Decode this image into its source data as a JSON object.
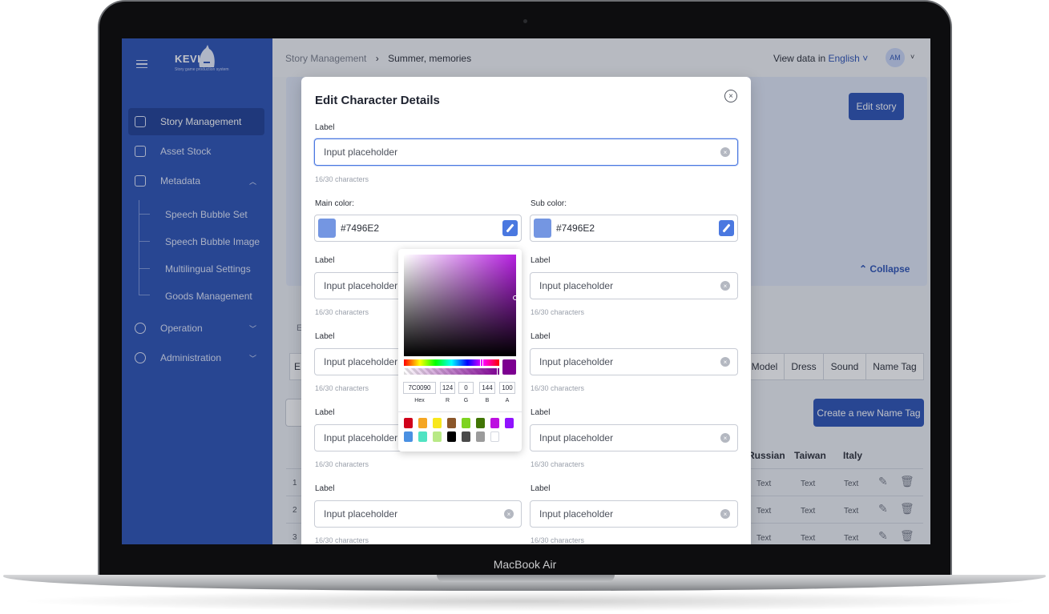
{
  "device": {
    "label": "MacBook Air"
  },
  "sidebar": {
    "logo": "KEVIN",
    "logo_subtitle": "Story game production system",
    "items": [
      {
        "label": "Story Management",
        "icon": "book-icon",
        "active": true
      },
      {
        "label": "Asset Stock",
        "icon": "asset-icon"
      },
      {
        "label": "Metadata",
        "icon": "code-window-icon",
        "expanded": true
      },
      {
        "label": "Operation",
        "icon": "gear-icon"
      },
      {
        "label": "Administration",
        "icon": "user-shield-icon"
      }
    ],
    "metadata_children": [
      "Speech Bubble Set",
      "Speech Bubble Image",
      "Multilingual Settings",
      "Goods Management"
    ]
  },
  "header": {
    "breadcrumb": [
      "Story Management",
      "Summer, memories"
    ],
    "separator": "›",
    "view_data_label": "View data in",
    "language": "English ˅",
    "avatar_initials": "AM",
    "chevron": "˅"
  },
  "banner": {
    "edit_button": "Edit story",
    "collapse_label": "Collapse",
    "collapse_icon": "⌃"
  },
  "background_page": {
    "tab_peek": "E",
    "segment_peek": "E",
    "segments": [
      "Model",
      "Dress",
      "Sound",
      "Name Tag"
    ],
    "create_button": "Create a new Name Tag",
    "columns": [
      "Russian",
      "Taiwan",
      "Italy"
    ],
    "rows": [
      {
        "num": "1",
        "cells": [
          "Text",
          "Text",
          "Text"
        ]
      },
      {
        "num": "2",
        "cells": [
          "Text",
          "Text",
          "Text"
        ]
      },
      {
        "num": "3",
        "cells": [
          "Text",
          "Text",
          "Text"
        ]
      }
    ],
    "edit_icon": "✎",
    "delete_icon": "🗑"
  },
  "modal": {
    "title": "Edit Character Details",
    "close_icon": "×",
    "clear_icon": "×",
    "top_field": {
      "label": "Label",
      "placeholder": "Input placeholder",
      "hint": "16/30 characters"
    },
    "main_color": {
      "label": "Main color:",
      "value": "#7496E2",
      "swatch": "#7496E2"
    },
    "sub_color": {
      "label": "Sub color:",
      "value": "#7496E2",
      "swatch": "#7496E2"
    },
    "grid_fields": [
      {
        "label": "Label",
        "placeholder": "Input placeholder",
        "hint": "16/30 characters"
      },
      {
        "label": "Label",
        "placeholder": "Input placeholder",
        "hint": "16/30 characters"
      },
      {
        "label": "Label",
        "placeholder": "Input placeholder",
        "hint": "16/30 characters"
      },
      {
        "label": "Label",
        "placeholder": "Input placeholder",
        "hint": "16/30 characters"
      },
      {
        "label": "Label",
        "placeholder": "Input placeholder",
        "hint": "16/30 characters"
      },
      {
        "label": "Label",
        "placeholder": "Input placeholder",
        "hint": "16/30 characters"
      },
      {
        "label": "Label",
        "placeholder": "Input placeholder",
        "hint": "16/30 characters"
      },
      {
        "label": "Label",
        "placeholder": "Input placeholder",
        "hint": "16/30 characters"
      }
    ]
  },
  "color_picker": {
    "hue_color": "#b51fe0",
    "selected_color": "#7c0090",
    "fields": {
      "hex": {
        "value": "7C0090",
        "caption": "Hex"
      },
      "r": {
        "value": "124",
        "caption": "R"
      },
      "g": {
        "value": "0",
        "caption": "G"
      },
      "b": {
        "value": "144",
        "caption": "B"
      },
      "a": {
        "value": "100",
        "caption": "A"
      }
    },
    "presets": [
      "#d0021b",
      "#f5a623",
      "#f8e71c",
      "#8b572a",
      "#7ed321",
      "#417505",
      "#bd10e0",
      "#9013fe",
      "#4a90e2",
      "#50e3c2",
      "#b8e986",
      "#000000",
      "#4a4a4a",
      "#9b9b9b",
      "#ffffff"
    ]
  }
}
